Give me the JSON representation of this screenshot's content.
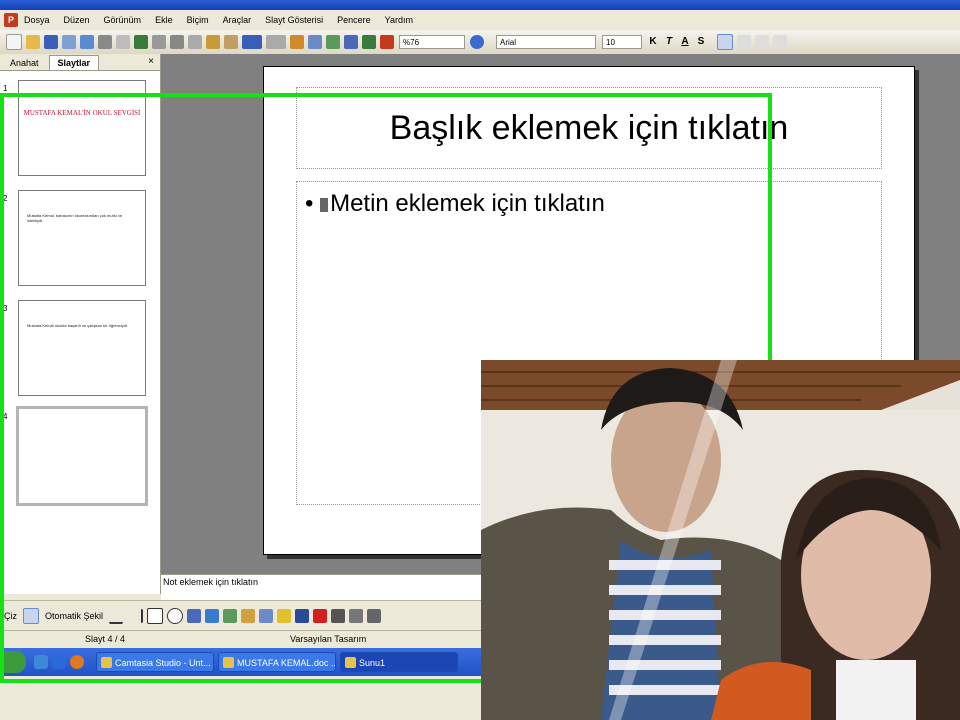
{
  "menu": [
    "Dosya",
    "Düzen",
    "Görünüm",
    "Ekle",
    "Biçim",
    "Araçlar",
    "Slayt Gösterisi",
    "Pencere",
    "Yardım"
  ],
  "toolbar": {
    "zoom": "%76",
    "font": "Arial",
    "size": "10"
  },
  "panel": {
    "tabs": [
      "Anahat",
      "Slaytlar"
    ],
    "close": "×"
  },
  "thumbs": [
    {
      "num": "1",
      "title": "MUSTAFA KEMAL'İN OKUL SEVGİSİ"
    },
    {
      "num": "2",
      "text": "Mustafa Kemal, babasının okumasından çok mutlu ve istekliydi."
    },
    {
      "num": "3",
      "text": "Mustafa Kemal okulda başarılı ve çalışkan bir öğrenciydi."
    },
    {
      "num": "4"
    }
  ],
  "slide": {
    "title": "Başlık eklemek için tıklatın",
    "body": "Metin eklemek için tıklatın"
  },
  "notes": "Not eklemek için tıklatın",
  "drawbar": {
    "draw": "Çiz",
    "autoshape": "Otomatik Şekil"
  },
  "status": {
    "slide": "Slayt 4 / 4",
    "design": "Varsayılan Tasarım"
  },
  "taskbar": [
    "Camtasia Studio - Unt...",
    "MUSTAFA KEMAL.doc ...",
    "Sunu1"
  ],
  "colors": {
    "highlight": "#16e016",
    "slide_title": "#c0143c",
    "taskbar": "#2250c8"
  }
}
